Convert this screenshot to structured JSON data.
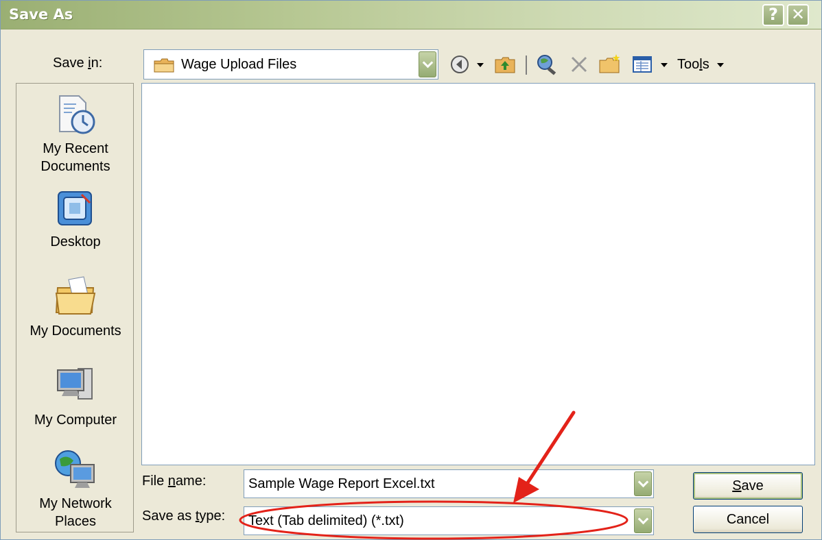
{
  "window": {
    "title": "Save As",
    "help_glyph": "?",
    "close_glyph": "✕"
  },
  "save_in": {
    "label_pre": "Save ",
    "label_key": "i",
    "label_post": "n:",
    "value": "Wage Upload Files"
  },
  "toolbar": {
    "tools_pre": "Too",
    "tools_key": "l",
    "tools_post": "s"
  },
  "places": [
    {
      "label_line1": "My Recent",
      "label_line2": "Documents",
      "icon": "recent-documents-icon"
    },
    {
      "label_line1": "Desktop",
      "label_line2": "",
      "icon": "desktop-icon"
    },
    {
      "label_line1": "My Documents",
      "label_line2": "",
      "icon": "my-documents-icon"
    },
    {
      "label_line1": "My Computer",
      "label_line2": "",
      "icon": "my-computer-icon"
    },
    {
      "label_line1": "My Network",
      "label_line2": "Places",
      "icon": "network-places-icon"
    }
  ],
  "file_name": {
    "label_pre": "File ",
    "label_key": "n",
    "label_post": "ame:",
    "value": "Sample Wage Report Excel.txt"
  },
  "file_type": {
    "label_pre": "Save as ",
    "label_key": "t",
    "label_post": "ype:",
    "value": "Text (Tab delimited) (*.txt)"
  },
  "buttons": {
    "save_key": "S",
    "save_post": "ave",
    "cancel": "Cancel"
  },
  "annotation_color": "#e32219"
}
